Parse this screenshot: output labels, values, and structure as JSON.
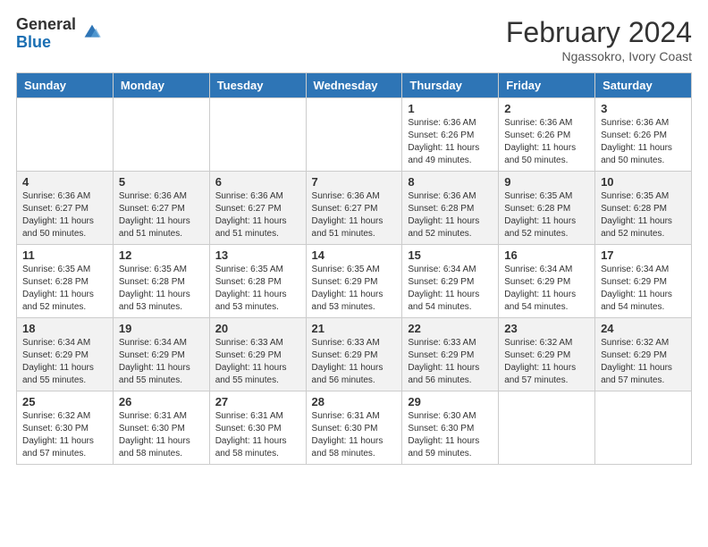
{
  "logo": {
    "general": "General",
    "blue": "Blue"
  },
  "header": {
    "month_year": "February 2024",
    "location": "Ngassokro, Ivory Coast"
  },
  "days_of_week": [
    "Sunday",
    "Monday",
    "Tuesday",
    "Wednesday",
    "Thursday",
    "Friday",
    "Saturday"
  ],
  "weeks": [
    [
      {
        "day": "",
        "info": ""
      },
      {
        "day": "",
        "info": ""
      },
      {
        "day": "",
        "info": ""
      },
      {
        "day": "",
        "info": ""
      },
      {
        "day": "1",
        "info": "Sunrise: 6:36 AM\nSunset: 6:26 PM\nDaylight: 11 hours and 49 minutes."
      },
      {
        "day": "2",
        "info": "Sunrise: 6:36 AM\nSunset: 6:26 PM\nDaylight: 11 hours and 50 minutes."
      },
      {
        "day": "3",
        "info": "Sunrise: 6:36 AM\nSunset: 6:26 PM\nDaylight: 11 hours and 50 minutes."
      }
    ],
    [
      {
        "day": "4",
        "info": "Sunrise: 6:36 AM\nSunset: 6:27 PM\nDaylight: 11 hours and 50 minutes."
      },
      {
        "day": "5",
        "info": "Sunrise: 6:36 AM\nSunset: 6:27 PM\nDaylight: 11 hours and 51 minutes."
      },
      {
        "day": "6",
        "info": "Sunrise: 6:36 AM\nSunset: 6:27 PM\nDaylight: 11 hours and 51 minutes."
      },
      {
        "day": "7",
        "info": "Sunrise: 6:36 AM\nSunset: 6:27 PM\nDaylight: 11 hours and 51 minutes."
      },
      {
        "day": "8",
        "info": "Sunrise: 6:36 AM\nSunset: 6:28 PM\nDaylight: 11 hours and 52 minutes."
      },
      {
        "day": "9",
        "info": "Sunrise: 6:35 AM\nSunset: 6:28 PM\nDaylight: 11 hours and 52 minutes."
      },
      {
        "day": "10",
        "info": "Sunrise: 6:35 AM\nSunset: 6:28 PM\nDaylight: 11 hours and 52 minutes."
      }
    ],
    [
      {
        "day": "11",
        "info": "Sunrise: 6:35 AM\nSunset: 6:28 PM\nDaylight: 11 hours and 52 minutes."
      },
      {
        "day": "12",
        "info": "Sunrise: 6:35 AM\nSunset: 6:28 PM\nDaylight: 11 hours and 53 minutes."
      },
      {
        "day": "13",
        "info": "Sunrise: 6:35 AM\nSunset: 6:28 PM\nDaylight: 11 hours and 53 minutes."
      },
      {
        "day": "14",
        "info": "Sunrise: 6:35 AM\nSunset: 6:29 PM\nDaylight: 11 hours and 53 minutes."
      },
      {
        "day": "15",
        "info": "Sunrise: 6:34 AM\nSunset: 6:29 PM\nDaylight: 11 hours and 54 minutes."
      },
      {
        "day": "16",
        "info": "Sunrise: 6:34 AM\nSunset: 6:29 PM\nDaylight: 11 hours and 54 minutes."
      },
      {
        "day": "17",
        "info": "Sunrise: 6:34 AM\nSunset: 6:29 PM\nDaylight: 11 hours and 54 minutes."
      }
    ],
    [
      {
        "day": "18",
        "info": "Sunrise: 6:34 AM\nSunset: 6:29 PM\nDaylight: 11 hours and 55 minutes."
      },
      {
        "day": "19",
        "info": "Sunrise: 6:34 AM\nSunset: 6:29 PM\nDaylight: 11 hours and 55 minutes."
      },
      {
        "day": "20",
        "info": "Sunrise: 6:33 AM\nSunset: 6:29 PM\nDaylight: 11 hours and 55 minutes."
      },
      {
        "day": "21",
        "info": "Sunrise: 6:33 AM\nSunset: 6:29 PM\nDaylight: 11 hours and 56 minutes."
      },
      {
        "day": "22",
        "info": "Sunrise: 6:33 AM\nSunset: 6:29 PM\nDaylight: 11 hours and 56 minutes."
      },
      {
        "day": "23",
        "info": "Sunrise: 6:32 AM\nSunset: 6:29 PM\nDaylight: 11 hours and 57 minutes."
      },
      {
        "day": "24",
        "info": "Sunrise: 6:32 AM\nSunset: 6:29 PM\nDaylight: 11 hours and 57 minutes."
      }
    ],
    [
      {
        "day": "25",
        "info": "Sunrise: 6:32 AM\nSunset: 6:30 PM\nDaylight: 11 hours and 57 minutes."
      },
      {
        "day": "26",
        "info": "Sunrise: 6:31 AM\nSunset: 6:30 PM\nDaylight: 11 hours and 58 minutes."
      },
      {
        "day": "27",
        "info": "Sunrise: 6:31 AM\nSunset: 6:30 PM\nDaylight: 11 hours and 58 minutes."
      },
      {
        "day": "28",
        "info": "Sunrise: 6:31 AM\nSunset: 6:30 PM\nDaylight: 11 hours and 58 minutes."
      },
      {
        "day": "29",
        "info": "Sunrise: 6:30 AM\nSunset: 6:30 PM\nDaylight: 11 hours and 59 minutes."
      },
      {
        "day": "",
        "info": ""
      },
      {
        "day": "",
        "info": ""
      }
    ]
  ]
}
